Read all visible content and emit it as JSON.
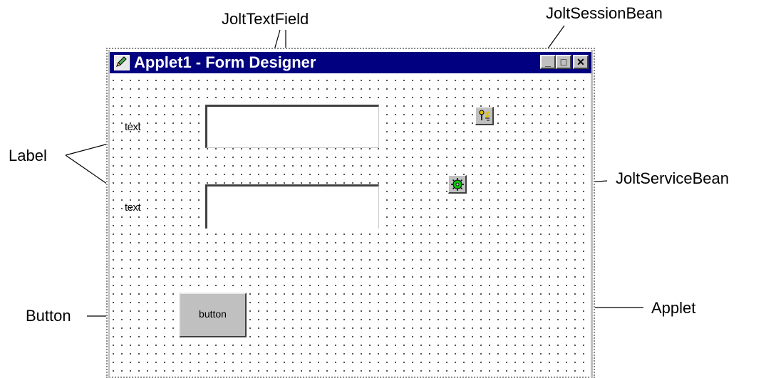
{
  "callouts": {
    "textfield": "JoltTextField",
    "session_bean": "JoltSessionBean",
    "label": "Label",
    "service_bean": "JoltServiceBean",
    "button": "Button",
    "applet": "Applet"
  },
  "window": {
    "title": "Applet1 - Form Designer",
    "minimize": "_",
    "maximize": "□",
    "close": "✕"
  },
  "form": {
    "label1": "text",
    "label2": "text",
    "button_label": "button"
  },
  "icons": {
    "title": "pen-icon",
    "session_bean": "session-bean-icon",
    "service_bean": "service-bean-icon"
  },
  "colors": {
    "titlebar": "#000080",
    "control_face": "#c0c0c0",
    "service_bean_glyph": "#00cc00",
    "session_bean_glyph": "#e0c000"
  }
}
